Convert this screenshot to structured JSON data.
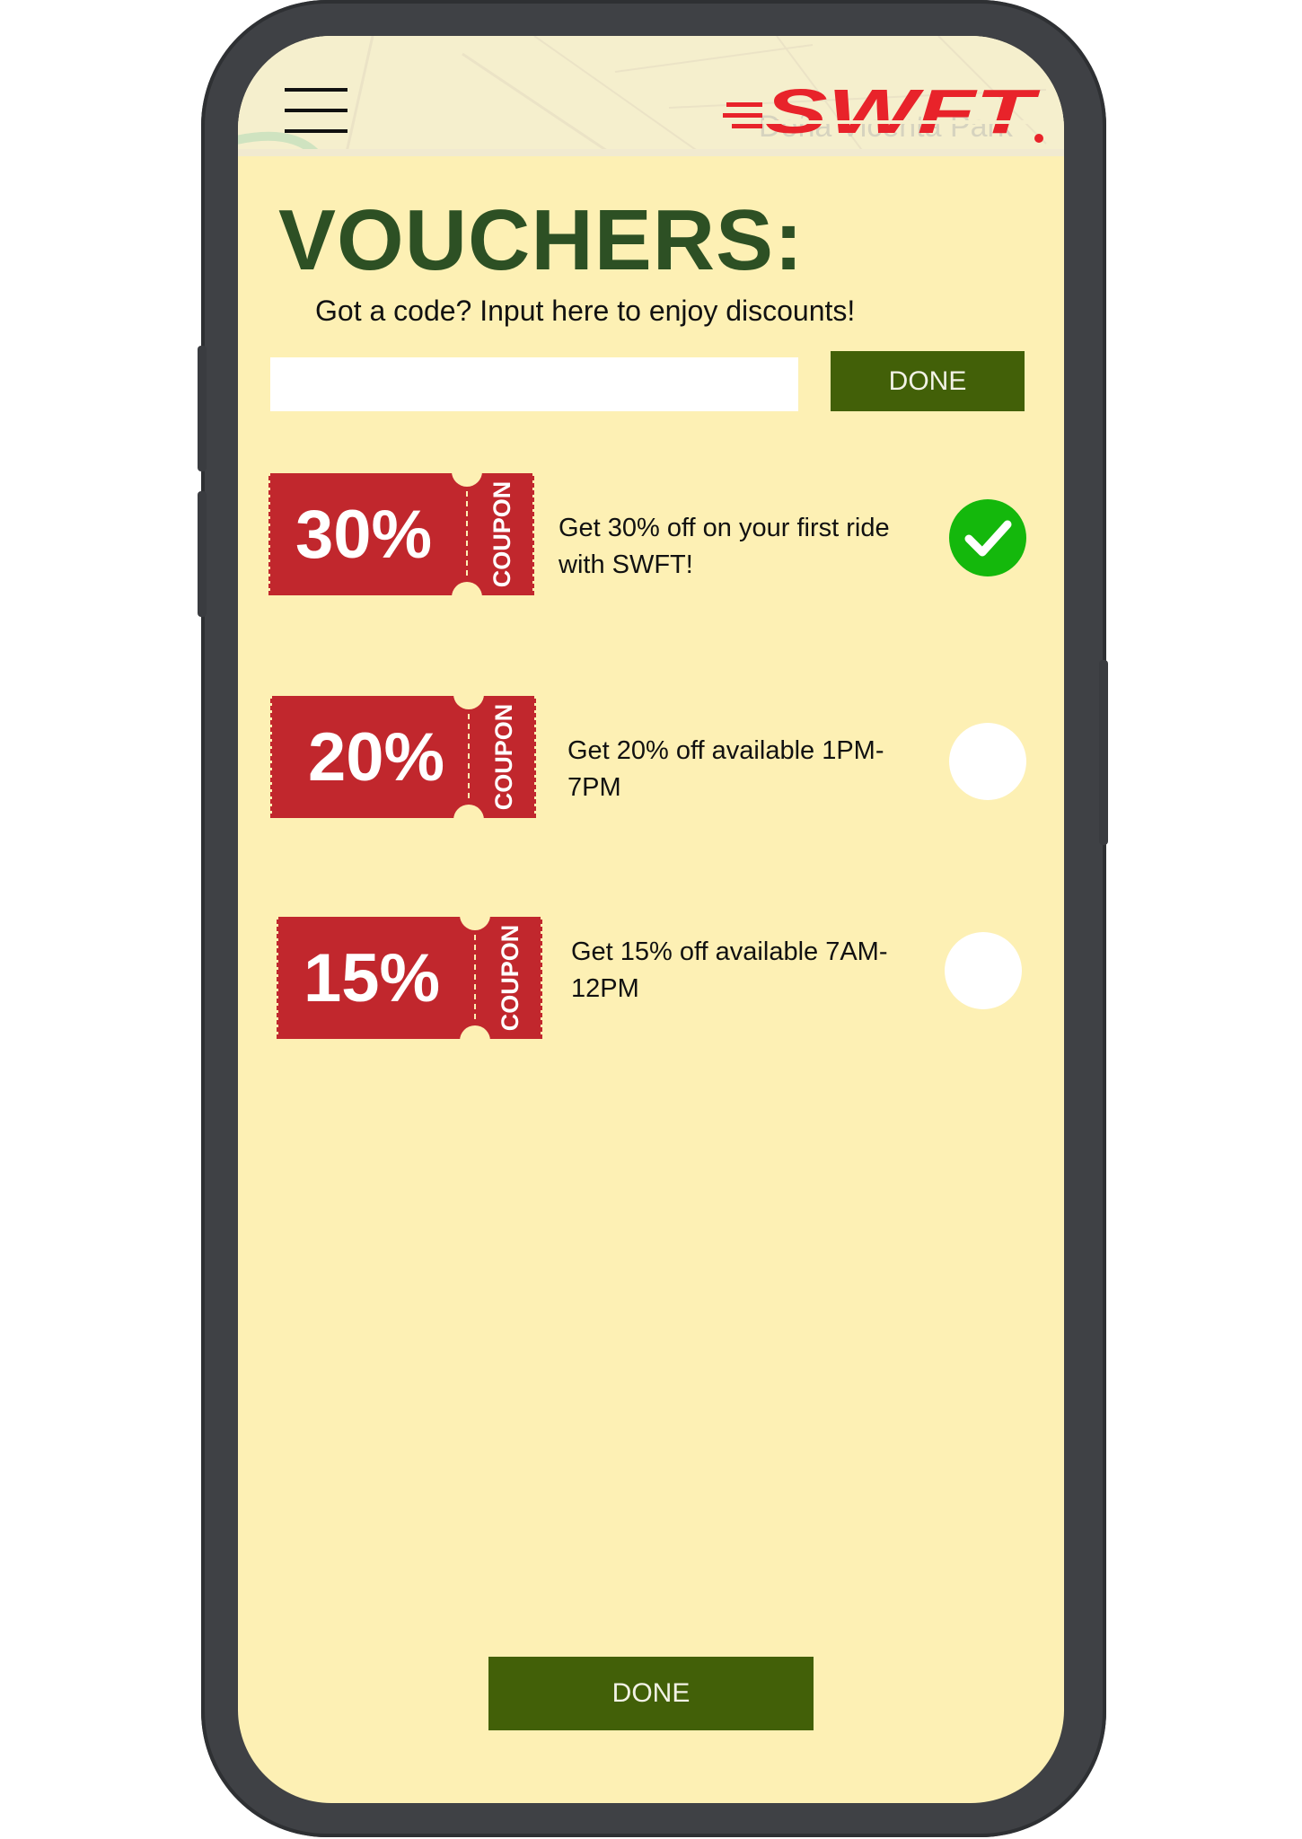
{
  "header": {
    "menu_icon": "hamburger-menu-icon",
    "logo_text": "SWFT",
    "map_labels": [
      "Doña Vicenta Park"
    ]
  },
  "page": {
    "title": "VOUCHERS:",
    "subtitle": "Got a code? Input here to enjoy discounts!"
  },
  "code_entry": {
    "value": "",
    "placeholder": "",
    "done_label": "DONE"
  },
  "vouchers": [
    {
      "percent": "30%",
      "badge": "COUPON",
      "description": "Get 30% off on your first ride with SWFT!",
      "selected": true
    },
    {
      "percent": "20%",
      "badge": "COUPON",
      "description": "Get 20% off available 1PM-7PM",
      "selected": false
    },
    {
      "percent": "15%",
      "badge": "COUPON",
      "description": "Get 15% off available 7AM-12PM",
      "selected": false
    }
  ],
  "footer": {
    "done_label": "DONE"
  },
  "colors": {
    "screen_background": "#fdf0b4",
    "title_green": "#2d5024",
    "button_green": "#426008",
    "coupon_red": "#c1272d",
    "logo_red": "#e8232a",
    "check_green": "#14b80c",
    "phone_frame": "#3f4145"
  }
}
